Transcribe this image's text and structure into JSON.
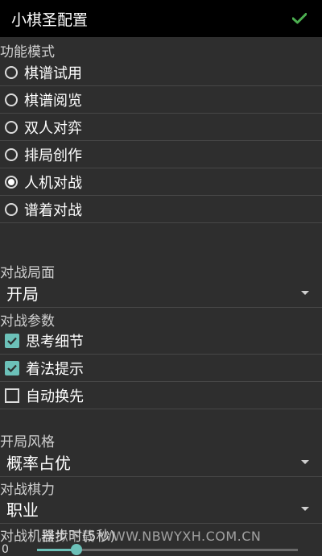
{
  "titlebar": {
    "title": "小棋圣配置",
    "confirm_icon": "check-icon",
    "accent": "#4caf50"
  },
  "mode_section": {
    "label": "功能模式",
    "options": [
      {
        "label": "棋谱试用",
        "selected": false
      },
      {
        "label": "棋谱阅览",
        "selected": false
      },
      {
        "label": "双人对弈",
        "selected": false
      },
      {
        "label": "排局创作",
        "selected": false
      },
      {
        "label": "人机对战",
        "selected": true
      },
      {
        "label": "谱着对战",
        "selected": false
      }
    ]
  },
  "board_section": {
    "label": "对战局面",
    "value": "开局"
  },
  "params_section": {
    "label": "对战参数",
    "options": [
      {
        "label": "思考细节",
        "checked": true
      },
      {
        "label": "着法提示",
        "checked": true
      },
      {
        "label": "自动换先",
        "checked": false
      }
    ]
  },
  "style_section": {
    "label": "开局风格",
    "value": "概率占优"
  },
  "strength_section": {
    "label": "对战棋力",
    "value": "职业"
  },
  "time_section": {
    "label": "对战机器步时(5秒)",
    "slider_value_label": "0",
    "slider_fraction": 0.15
  },
  "watermark": "模拟下载 WWW.NBWYXH.COM.CN",
  "colors": {
    "background": "#2e2e2e",
    "titlebar": "#000000",
    "accent": "#6cc1b9"
  }
}
